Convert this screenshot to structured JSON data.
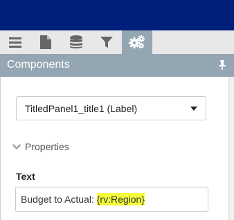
{
  "toolbar": {
    "items": [
      {
        "icon": "hamburger-menu-icon"
      },
      {
        "icon": "document-icon"
      },
      {
        "icon": "database-icon"
      },
      {
        "icon": "filter-icon"
      },
      {
        "icon": "gears-icon",
        "active": true
      }
    ]
  },
  "panel": {
    "title": "Components",
    "pin_icon": "pin-icon"
  },
  "component_select": {
    "selected": "TitledPanel1_title1 (Label)"
  },
  "properties": {
    "label": "Properties",
    "expanded": true
  },
  "text_field": {
    "label": "Text",
    "value_prefix": "Budget to Actual: ",
    "value_highlight": "{rv:Region}"
  },
  "colors": {
    "topbar": "#001f7a",
    "accent": "#95a6b3",
    "highlight": "#f4ff3c"
  }
}
